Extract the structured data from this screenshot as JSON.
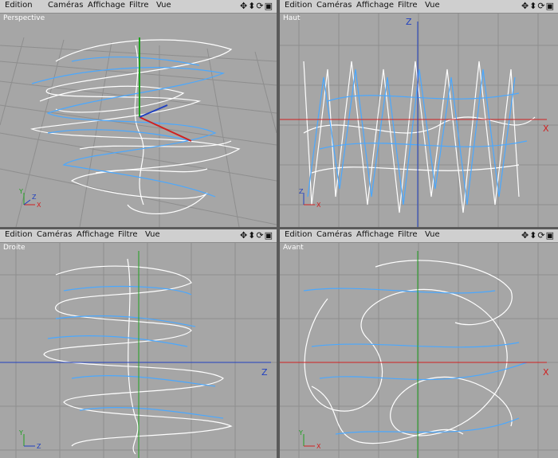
{
  "menus": [
    "Edition",
    "Caméras",
    "Affichage",
    "Filtre",
    "Vue"
  ],
  "nav_icons": [
    "move-icon",
    "zoom-icon",
    "rotate-icon"
  ],
  "viewports": [
    {
      "title": "Perspective",
      "horizontal_axis": "X",
      "vertical_axis": "Y",
      "depth_axis": "Z"
    },
    {
      "title": "Haut",
      "horizontal_axis": "X",
      "vertical_axis": "Z"
    },
    {
      "title": "Droite",
      "horizontal_axis": "Z",
      "vertical_axis": "Y"
    },
    {
      "title": "Avant",
      "horizontal_axis": "X",
      "vertical_axis": "Y"
    }
  ],
  "colors": {
    "background": "#a6a6a6",
    "grid": "#8e8e8e",
    "curve_white": "#ffffff",
    "curve_blue": "#4aa8ff",
    "axis_x": "#d02020",
    "axis_y": "#20a020",
    "axis_z": "#2040c0"
  }
}
